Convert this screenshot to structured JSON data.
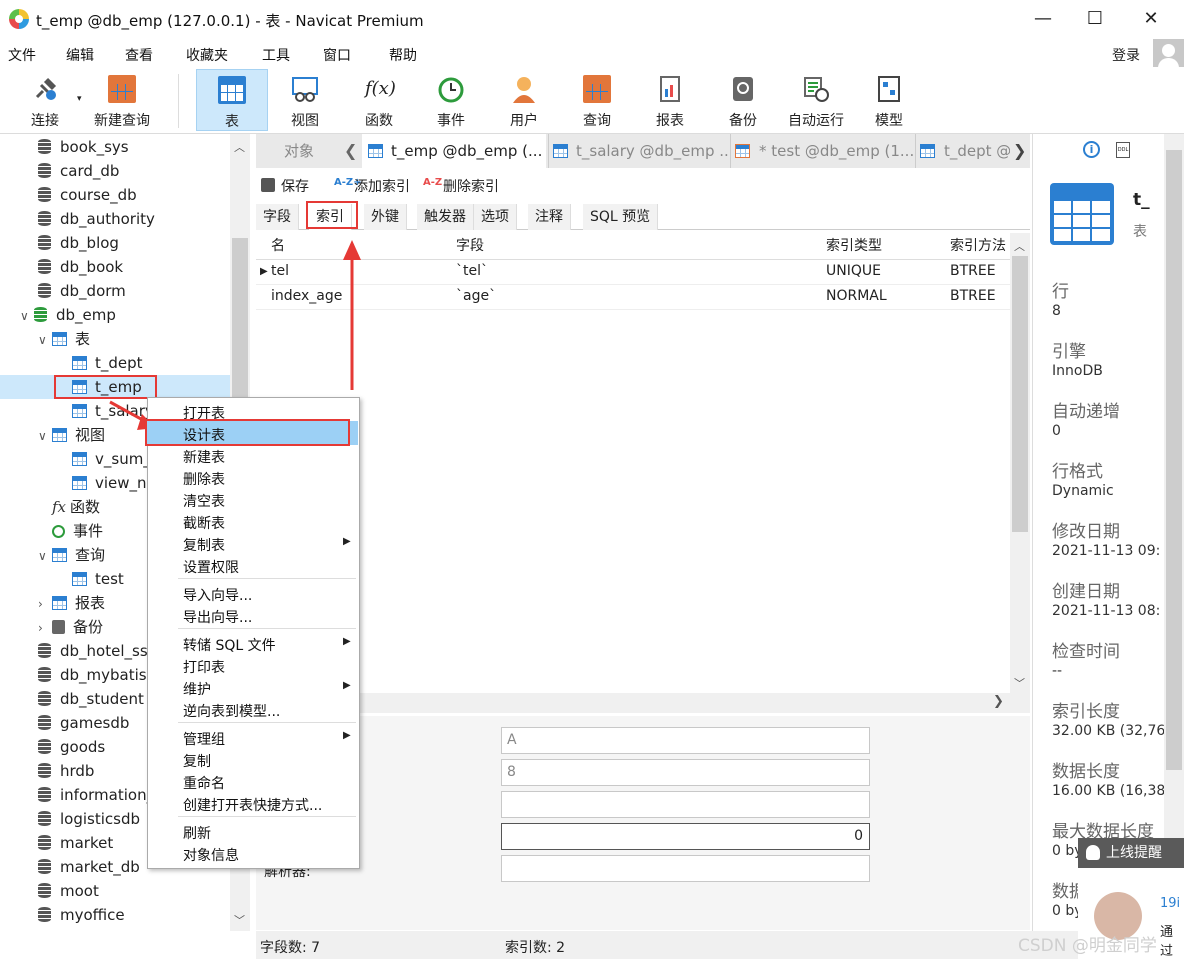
{
  "window": {
    "title": "t_emp @db_emp (127.0.0.1) - 表 - Navicat Premium",
    "minimize": "—",
    "maximize": "☐",
    "close": "✕"
  },
  "menu": [
    "文件",
    "编辑",
    "查看",
    "收藏夹",
    "工具",
    "窗口",
    "帮助"
  ],
  "login": "登录",
  "toolbar": {
    "connect": "连接",
    "new_query": "新建查询",
    "table": "表",
    "view": "视图",
    "function": "函数",
    "event": "事件",
    "user": "用户",
    "query": "查询",
    "report": "报表",
    "backup": "备份",
    "automation": "自动运行",
    "model": "模型",
    "func_glyph": "f(x)"
  },
  "tree": {
    "dbs_top": [
      "book_sys",
      "card_db",
      "course_db",
      "db_authority",
      "db_blog",
      "db_book",
      "db_dorm"
    ],
    "db_emp": "db_emp",
    "tables": "表",
    "t_dept": "t_dept",
    "t_emp": "t_emp",
    "t_salary": "t_salary",
    "views": "视图",
    "v_sum": "v_sum_",
    "view_na": "view_na",
    "functions": "函数",
    "events": "事件",
    "queries": "查询",
    "test": "test",
    "reports": "报表",
    "backups": "备份",
    "dbs_bottom": [
      "db_hotel_ss",
      "db_mybatis",
      "db_student",
      "gamesdb",
      "goods",
      "hrdb",
      "information_",
      "logisticsdb",
      "market",
      "market_db",
      "moot",
      "myoffice"
    ]
  },
  "tabs": {
    "objects": "对象",
    "t_emp": "t_emp @db_emp (...",
    "t_salary": "t_salary @db_emp ...",
    "test": "* test @db_emp (1...",
    "t_dept": "t_dept @"
  },
  "subtoolbar": {
    "save": "保存",
    "add_index": "添加索引",
    "delete_index": "删除索引"
  },
  "inner_tabs": [
    "字段",
    "索引",
    "外键",
    "触发器",
    "选项",
    "注释",
    "SQL 预览"
  ],
  "grid": {
    "headers": [
      "名",
      "字段",
      "索引类型",
      "索引方法"
    ],
    "rows": [
      [
        "tel",
        "`tel`",
        "UNIQUE",
        "BTREE"
      ],
      [
        "index_age",
        "`age`",
        "NORMAL",
        "BTREE"
      ]
    ]
  },
  "form": {
    "v1": "A",
    "v2": "8",
    "v3": "",
    "v4": "0",
    "v5": "",
    "parser_label": "解析器:"
  },
  "status": {
    "field_count": "字段数: 7",
    "index_count": "索引数: 2"
  },
  "right": {
    "name": "t_",
    "type": "表",
    "items": [
      {
        "label": "行",
        "value": "8"
      },
      {
        "label": "引擎",
        "value": "InnoDB"
      },
      {
        "label": "自动递增",
        "value": "0"
      },
      {
        "label": "行格式",
        "value": "Dynamic"
      },
      {
        "label": "修改日期",
        "value": "2021-11-13 09:"
      },
      {
        "label": "创建日期",
        "value": "2021-11-13 08:"
      },
      {
        "label": "检查时间",
        "value": "--"
      },
      {
        "label": "索引长度",
        "value": "32.00 KB (32,76"
      },
      {
        "label": "数据长度",
        "value": "16.00 KB (16,38"
      },
      {
        "label": "最大数据长度",
        "value": "0 by"
      },
      {
        "label": "数据",
        "value": "0 by"
      }
    ]
  },
  "context_menu": [
    "打开表",
    "设计表",
    "新建表",
    "删除表",
    "清空表",
    "截断表",
    "复制表",
    "设置权限",
    "导入向导...",
    "导出向导...",
    "转储 SQL 文件",
    "打印表",
    "维护",
    "逆向表到模型...",
    "管理组",
    "复制",
    "重命名",
    "创建打开表快捷方式...",
    "刷新",
    "对象信息"
  ],
  "popup": {
    "title": "上线提醒",
    "line1": "19i",
    "line2": "通过"
  },
  "watermark": "CSDN @明金同学",
  "colors": {
    "accent": "#2b7fd1",
    "highlight": "#cde8fb",
    "annotation_red": "#e53935"
  }
}
